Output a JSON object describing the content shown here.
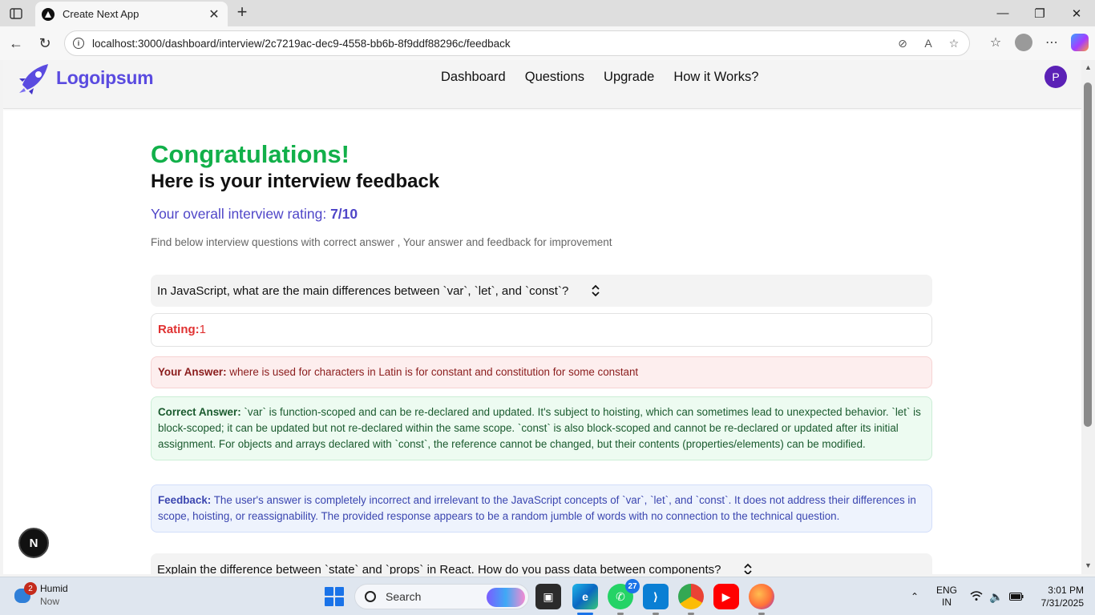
{
  "browser": {
    "tab_title": "Create Next App",
    "url": "localhost:3000/dashboard/interview/2c7219ac-dec9-4558-bb6b-8f9ddf88296c/feedback"
  },
  "app": {
    "logo_text": "Logoipsum",
    "nav": [
      "Dashboard",
      "Questions",
      "Upgrade",
      "How it Works?"
    ],
    "avatar_initial": "P",
    "next_badge": "N"
  },
  "page": {
    "heading": "Congratulations!",
    "subheading": "Here is your interview feedback",
    "rating_label": "Your overall interview rating:",
    "rating_value": "7/10",
    "hint": "Find below interview questions with correct answer , Your answer and feedback for improvement"
  },
  "questions": [
    {
      "question": "In JavaScript, what are the main differences between `var`, `let`, and `const`?",
      "rating_label": "Rating:",
      "rating": "1",
      "your_answer_label": "Your Answer:",
      "your_answer": "where is used for characters in Latin is for constant and constitution for some constant",
      "correct_answer_label": "Correct Answer:",
      "correct_answer": "`var` is function-scoped and can be re-declared and updated. It's subject to hoisting, which can sometimes lead to unexpected behavior. `let` is block-scoped; it can be updated but not re-declared within the same scope. `const` is also block-scoped and cannot be re-declared or updated after its initial assignment. For objects and arrays declared with `const`, the reference cannot be changed, but their contents (properties/elements) can be modified.",
      "feedback_label": "Feedback:",
      "feedback": "The user's answer is completely incorrect and irrelevant to the JavaScript concepts of `var`, `let`, and `const`. It does not address their differences in scope, hoisting, or reassignability. The provided response appears to be a random jumble of words with no connection to the technical question."
    },
    {
      "question": "Explain the difference between `state` and `props` in React. How do you pass data between components?"
    }
  ],
  "taskbar": {
    "weather_title": "Humid",
    "weather_sub": "Now",
    "weather_badge": "2",
    "search_placeholder": "Search",
    "whatsapp_badge": "27",
    "lang_top": "ENG",
    "lang_bottom": "IN",
    "time": "3:01 PM",
    "date": "7/31/2025"
  },
  "colors": {
    "brand": "#5a4be0",
    "success": "#12b04a",
    "rating_text": "#4f46c8",
    "danger": "#e03131"
  }
}
